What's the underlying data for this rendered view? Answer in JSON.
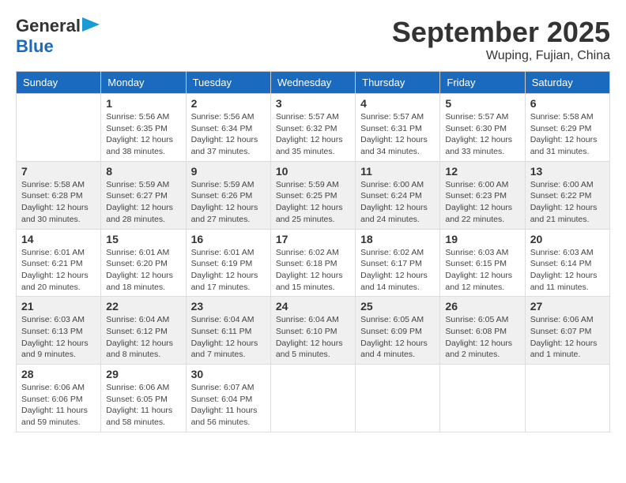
{
  "header": {
    "logo_line1": "General",
    "logo_line2": "Blue",
    "month": "September 2025",
    "location": "Wuping, Fujian, China"
  },
  "weekdays": [
    "Sunday",
    "Monday",
    "Tuesday",
    "Wednesday",
    "Thursday",
    "Friday",
    "Saturday"
  ],
  "weeks": [
    [
      {
        "day": "",
        "info": ""
      },
      {
        "day": "1",
        "info": "Sunrise: 5:56 AM\nSunset: 6:35 PM\nDaylight: 12 hours\nand 38 minutes."
      },
      {
        "day": "2",
        "info": "Sunrise: 5:56 AM\nSunset: 6:34 PM\nDaylight: 12 hours\nand 37 minutes."
      },
      {
        "day": "3",
        "info": "Sunrise: 5:57 AM\nSunset: 6:32 PM\nDaylight: 12 hours\nand 35 minutes."
      },
      {
        "day": "4",
        "info": "Sunrise: 5:57 AM\nSunset: 6:31 PM\nDaylight: 12 hours\nand 34 minutes."
      },
      {
        "day": "5",
        "info": "Sunrise: 5:57 AM\nSunset: 6:30 PM\nDaylight: 12 hours\nand 33 minutes."
      },
      {
        "day": "6",
        "info": "Sunrise: 5:58 AM\nSunset: 6:29 PM\nDaylight: 12 hours\nand 31 minutes."
      }
    ],
    [
      {
        "day": "7",
        "info": "Sunrise: 5:58 AM\nSunset: 6:28 PM\nDaylight: 12 hours\nand 30 minutes."
      },
      {
        "day": "8",
        "info": "Sunrise: 5:59 AM\nSunset: 6:27 PM\nDaylight: 12 hours\nand 28 minutes."
      },
      {
        "day": "9",
        "info": "Sunrise: 5:59 AM\nSunset: 6:26 PM\nDaylight: 12 hours\nand 27 minutes."
      },
      {
        "day": "10",
        "info": "Sunrise: 5:59 AM\nSunset: 6:25 PM\nDaylight: 12 hours\nand 25 minutes."
      },
      {
        "day": "11",
        "info": "Sunrise: 6:00 AM\nSunset: 6:24 PM\nDaylight: 12 hours\nand 24 minutes."
      },
      {
        "day": "12",
        "info": "Sunrise: 6:00 AM\nSunset: 6:23 PM\nDaylight: 12 hours\nand 22 minutes."
      },
      {
        "day": "13",
        "info": "Sunrise: 6:00 AM\nSunset: 6:22 PM\nDaylight: 12 hours\nand 21 minutes."
      }
    ],
    [
      {
        "day": "14",
        "info": "Sunrise: 6:01 AM\nSunset: 6:21 PM\nDaylight: 12 hours\nand 20 minutes."
      },
      {
        "day": "15",
        "info": "Sunrise: 6:01 AM\nSunset: 6:20 PM\nDaylight: 12 hours\nand 18 minutes."
      },
      {
        "day": "16",
        "info": "Sunrise: 6:01 AM\nSunset: 6:19 PM\nDaylight: 12 hours\nand 17 minutes."
      },
      {
        "day": "17",
        "info": "Sunrise: 6:02 AM\nSunset: 6:18 PM\nDaylight: 12 hours\nand 15 minutes."
      },
      {
        "day": "18",
        "info": "Sunrise: 6:02 AM\nSunset: 6:17 PM\nDaylight: 12 hours\nand 14 minutes."
      },
      {
        "day": "19",
        "info": "Sunrise: 6:03 AM\nSunset: 6:15 PM\nDaylight: 12 hours\nand 12 minutes."
      },
      {
        "day": "20",
        "info": "Sunrise: 6:03 AM\nSunset: 6:14 PM\nDaylight: 12 hours\nand 11 minutes."
      }
    ],
    [
      {
        "day": "21",
        "info": "Sunrise: 6:03 AM\nSunset: 6:13 PM\nDaylight: 12 hours\nand 9 minutes."
      },
      {
        "day": "22",
        "info": "Sunrise: 6:04 AM\nSunset: 6:12 PM\nDaylight: 12 hours\nand 8 minutes."
      },
      {
        "day": "23",
        "info": "Sunrise: 6:04 AM\nSunset: 6:11 PM\nDaylight: 12 hours\nand 7 minutes."
      },
      {
        "day": "24",
        "info": "Sunrise: 6:04 AM\nSunset: 6:10 PM\nDaylight: 12 hours\nand 5 minutes."
      },
      {
        "day": "25",
        "info": "Sunrise: 6:05 AM\nSunset: 6:09 PM\nDaylight: 12 hours\nand 4 minutes."
      },
      {
        "day": "26",
        "info": "Sunrise: 6:05 AM\nSunset: 6:08 PM\nDaylight: 12 hours\nand 2 minutes."
      },
      {
        "day": "27",
        "info": "Sunrise: 6:06 AM\nSunset: 6:07 PM\nDaylight: 12 hours\nand 1 minute."
      }
    ],
    [
      {
        "day": "28",
        "info": "Sunrise: 6:06 AM\nSunset: 6:06 PM\nDaylight: 11 hours\nand 59 minutes."
      },
      {
        "day": "29",
        "info": "Sunrise: 6:06 AM\nSunset: 6:05 PM\nDaylight: 11 hours\nand 58 minutes."
      },
      {
        "day": "30",
        "info": "Sunrise: 6:07 AM\nSunset: 6:04 PM\nDaylight: 11 hours\nand 56 minutes."
      },
      {
        "day": "",
        "info": ""
      },
      {
        "day": "",
        "info": ""
      },
      {
        "day": "",
        "info": ""
      },
      {
        "day": "",
        "info": ""
      }
    ]
  ],
  "row_shading": [
    false,
    true,
    false,
    true,
    false
  ]
}
